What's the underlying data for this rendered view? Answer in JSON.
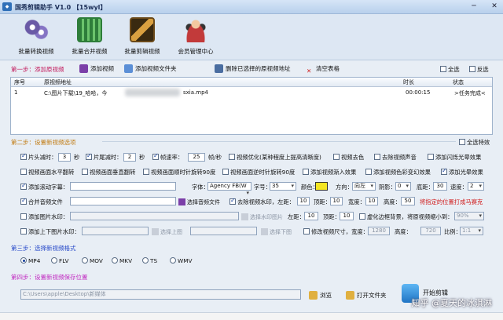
{
  "window": {
    "title": "国秀剪辑助手 V1.0   【15wyl】",
    "icon": "app-icon",
    "minimize": "─",
    "maximize": "□",
    "close": "✕"
  },
  "toolbar": {
    "items": [
      {
        "label": "批量转换视频",
        "icon": "film-reel-icon",
        "color": "#6a5aa6"
      },
      {
        "label": "批量合并视频",
        "icon": "film-stack-icon",
        "color": "#3a9a48"
      },
      {
        "label": "批量剪辑视频",
        "icon": "film-scissors-icon",
        "color": "#b07a2c"
      },
      {
        "label": "会员管理中心",
        "icon": "members-icon",
        "color": "#c23a3a"
      }
    ]
  },
  "step1": {
    "title": "第一步：添加原视频",
    "add_video": "添加视频",
    "add_folder": "添加视频文件夹",
    "delete_selected": "删除已选择的原视频地址",
    "clear_list": "清空表格",
    "select_all": "全选",
    "invert": "反选"
  },
  "table": {
    "headers": [
      "序号",
      "原视频地址",
      "时长",
      "状态"
    ],
    "rows": [
      {
        "index": "1",
        "path_start": "C:\\图片下载\\19_哈哈，今",
        "path_end": "sxia.mp4",
        "duration": "00:00:15",
        "status": ">任务完成<"
      }
    ]
  },
  "step2": {
    "title": "第二步：设置新视频选项",
    "select_all_effects": "全选特效",
    "row1": {
      "head_cut": "片头减时：",
      "head_val": "3",
      "head_unit": "秒",
      "tail_cut": "片尾减时：",
      "tail_val": "2",
      "tail_unit": "秒",
      "frame_rate": "帧速率：",
      "frame_val": "25",
      "frame_unit": "帧/秒",
      "optimize": "视频优化(某种程度上提高清晰度)",
      "decolor": "视频去色",
      "remove_audio": "去除视频声音",
      "flash": "添加闪烁光晕效果"
    },
    "row2": {
      "hflip": "视频画面水平翻转",
      "vflip": "视频画面垂直翻转",
      "rot_cw": "视频画面顺时针旋转90度",
      "rot_ccw": "视频画面逆时针旋转90度",
      "fade_in": "添加视频渐入效果",
      "color_change": "添加视频色彩变幻效果",
      "light": "添加光晕效果"
    },
    "row3": {
      "subtitle": "添加滚动字幕：",
      "subtitle_val": "",
      "font": "字体：",
      "font_val": "Agency FB(W",
      "size": "字号：",
      "size_val": "35",
      "color": "颜色：",
      "direction": "方向：",
      "direction_val": "向左",
      "shadow": "阴影：",
      "shadow_val": "0",
      "bottom": "底距：",
      "bottom_val": "30",
      "speed": "速度：",
      "speed_val": "2"
    },
    "row4": {
      "merge_audio": "合并音频文件",
      "merge_audio_val": "",
      "select_audio": "选择音频文件",
      "remove_watermark": "去除视频水印，左距：",
      "wm_left": "10",
      "wm_top_label": "顶距：",
      "wm_top": "10",
      "wm_width_label": "宽度：",
      "wm_width": "10",
      "wm_height_label": "高度：",
      "wm_height": "50",
      "wm_hint": "将指定的位置打成马赛克"
    },
    "row5": {
      "add_image_wm": "添加图片水印：",
      "image_wm_val": "",
      "select_wm_image": "选择水印图片",
      "left_label": "左距：",
      "left_val": "10",
      "top_label": "顶距：",
      "top_val": "10",
      "blur_bg": "虚化边框背景，将原视频缩小到：",
      "blur_val": "90%"
    },
    "row6": {
      "add_cover": "添加上下图片水印：",
      "cover_top_val": "",
      "select_top": "选择上图",
      "cover_bottom_val": "",
      "select_bottom": "选择下图",
      "resize": "修改视频尺寸，宽度：",
      "width_val": "1280",
      "height_label": "高度：",
      "height_val": "720",
      "ratio_label": "比例：",
      "ratio_val": "1:1"
    }
  },
  "step3": {
    "title": "第三步：选择新视频格式",
    "formats": [
      "MP4",
      "FLV",
      "MOV",
      "MKV",
      "TS",
      "WMV"
    ],
    "selected": "MP4"
  },
  "step4": {
    "title": "第四步：设置新视频保存位置",
    "path": "C:\\Users\\apple\\Desktop\\新媒体",
    "browse": "浏览",
    "open_folder": "打开文件夹",
    "start": "开始剪辑"
  },
  "watermark": "知乎 @夏天的冰淇淋"
}
